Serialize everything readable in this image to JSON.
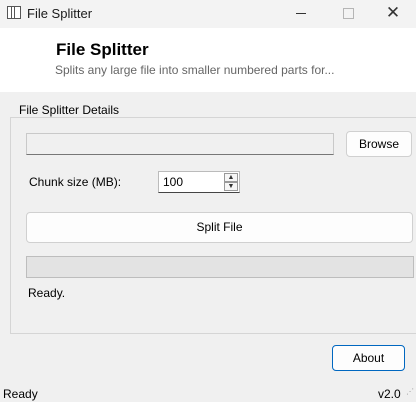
{
  "window": {
    "title": "File Splitter",
    "close_glyph": "✕"
  },
  "header": {
    "title": "File Splitter",
    "subtitle": "Splits any large file into smaller numbered parts for..."
  },
  "group": {
    "legend": "File Splitter Details"
  },
  "file": {
    "path": "",
    "browse_label": "Browse"
  },
  "chunk": {
    "label": "Chunk size (MB):",
    "value": "100",
    "up_glyph": "▲",
    "down_glyph": "▼"
  },
  "actions": {
    "split_label": "Split File",
    "about_label": "About"
  },
  "progress": {
    "fraction": 0,
    "fill_color": "#06b025"
  },
  "status": {
    "text": "Ready."
  },
  "statusbar": {
    "left": "Ready",
    "right": "v2.0"
  },
  "colors": {
    "accent": "#0067c0",
    "header_bg": "#ffffff",
    "window_bg": "#f0f0f0"
  }
}
